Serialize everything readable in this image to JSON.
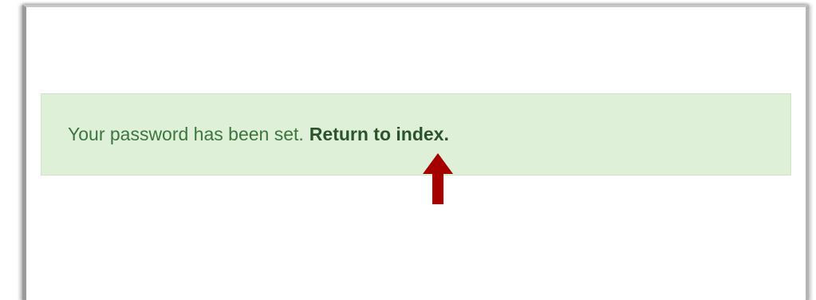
{
  "alert": {
    "message": "Your password has been set.",
    "link_label": "Return to index."
  },
  "colors": {
    "alert_background": "#dff0d8",
    "alert_text": "#3c763d",
    "link_text": "#2b542c",
    "annotation_arrow": "#a50000"
  },
  "annotation": {
    "icon": "up-arrow-icon"
  }
}
